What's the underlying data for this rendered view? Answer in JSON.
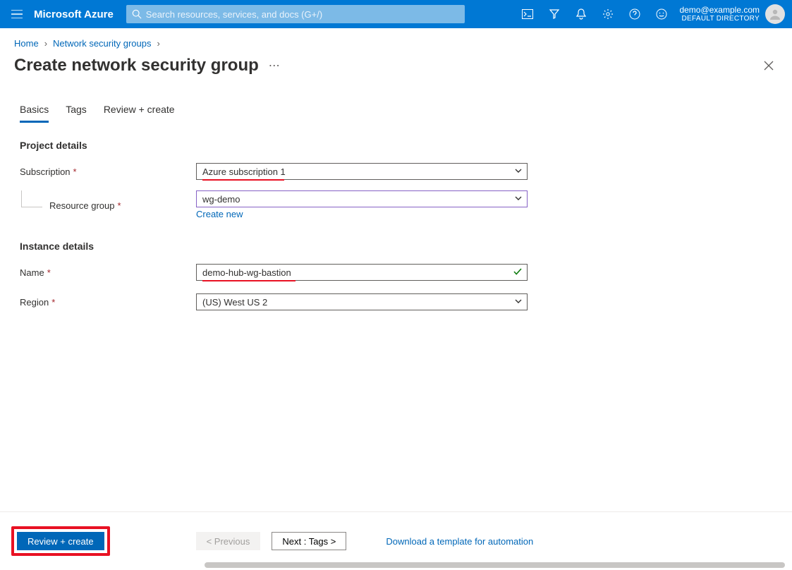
{
  "topbar": {
    "brand": "Microsoft Azure",
    "search_placeholder": "Search resources, services, and docs (G+/)",
    "account_email": "demo@example.com",
    "account_directory": "DEFAULT DIRECTORY"
  },
  "breadcrumb": {
    "home": "Home",
    "nsg": "Network security groups"
  },
  "page": {
    "title": "Create network security group"
  },
  "tabs": {
    "basics": "Basics",
    "tags": "Tags",
    "review": "Review + create"
  },
  "sections": {
    "project_details": "Project details",
    "instance_details": "Instance details"
  },
  "fields": {
    "subscription_label": "Subscription",
    "subscription_value": "Azure subscription 1",
    "resource_group_label": "Resource group",
    "resource_group_value": "wg-demo",
    "create_new": "Create new",
    "name_label": "Name",
    "name_value": "demo-hub-wg-bastion",
    "region_label": "Region",
    "region_value": "(US) West US 2"
  },
  "footer": {
    "review_create": "Review + create",
    "previous": "< Previous",
    "next": "Next : Tags >",
    "download_template": "Download a template for automation"
  }
}
